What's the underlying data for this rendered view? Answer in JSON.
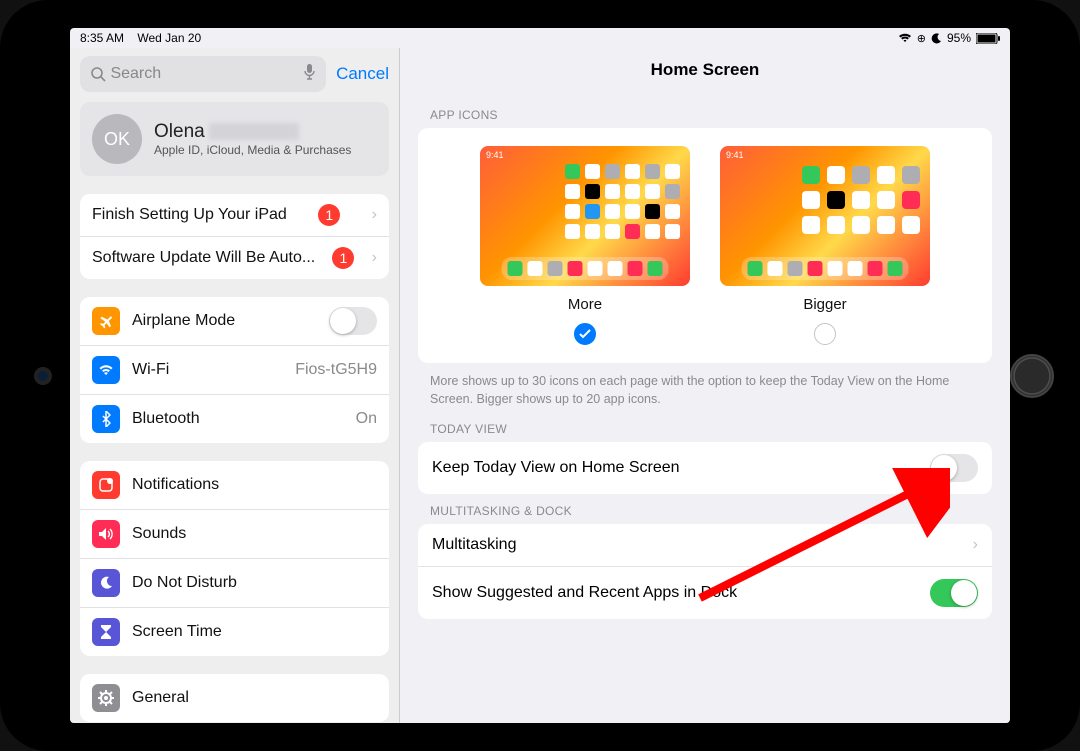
{
  "status": {
    "time": "8:35 AM",
    "date": "Wed Jan 20",
    "battery_pct": "95%"
  },
  "sidebar": {
    "search_placeholder": "Search",
    "cancel": "Cancel",
    "apple_id": {
      "initials": "OK",
      "name": "Olena",
      "sub": "Apple ID, iCloud, Media & Purchases"
    },
    "alerts": [
      {
        "label": "Finish Setting Up Your iPad",
        "badge": "1"
      },
      {
        "label": "Software Update Will Be Auto...",
        "badge": "1"
      }
    ],
    "group1": {
      "airplane": "Airplane Mode",
      "wifi": "Wi-Fi",
      "wifi_value": "Fios-tG5H9",
      "bluetooth": "Bluetooth",
      "bt_value": "On"
    },
    "group2": {
      "notifications": "Notifications",
      "sounds": "Sounds",
      "dnd": "Do Not Disturb",
      "screentime": "Screen Time"
    },
    "group3": {
      "general": "General"
    }
  },
  "main": {
    "title": "Home Screen",
    "app_icons_header": "APP ICONS",
    "option_more": "More",
    "option_bigger": "Bigger",
    "preview_time": "9:41",
    "footer_note": "More shows up to 30 icons on each page with the option to keep the Today View on the Home Screen. Bigger shows up to 20 app icons.",
    "today_header": "TODAY VIEW",
    "today_row": "Keep Today View on Home Screen",
    "multi_header": "MULTITASKING & DOCK",
    "multi_row": "Multitasking",
    "dock_row": "Show Suggested and Recent Apps in Dock"
  }
}
